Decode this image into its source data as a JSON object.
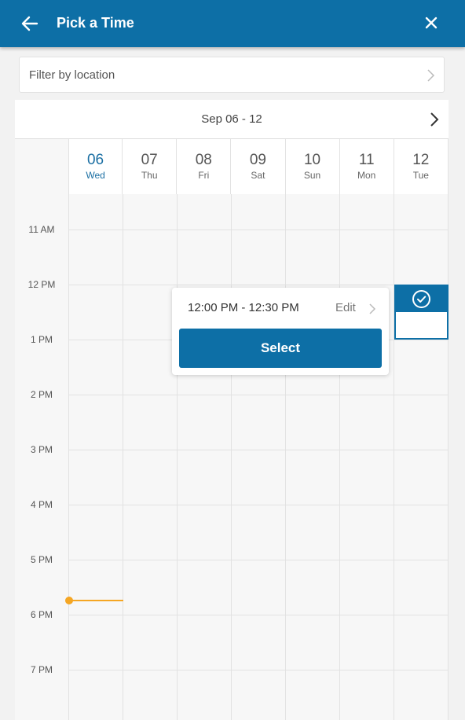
{
  "header": {
    "title": "Pick a Time",
    "back_icon": "arrow-left-icon",
    "close_icon": "close-icon"
  },
  "filter": {
    "label": "Filter by location",
    "icon": "chevron-right-icon"
  },
  "calendar": {
    "week_range": "Sep 06 - 12",
    "next_icon": "chevron-right-icon",
    "days": [
      {
        "num": "06",
        "dow": "Wed",
        "today": true
      },
      {
        "num": "07",
        "dow": "Thu"
      },
      {
        "num": "08",
        "dow": "Fri"
      },
      {
        "num": "09",
        "dow": "Sat"
      },
      {
        "num": "10",
        "dow": "Sun"
      },
      {
        "num": "11",
        "dow": "Mon"
      },
      {
        "num": "12",
        "dow": "Tue"
      }
    ],
    "times": [
      "11 AM",
      "12 PM",
      "1 PM",
      "2 PM",
      "3 PM",
      "4 PM",
      "5 PM",
      "6 PM",
      "7 PM"
    ],
    "selected_slot": {
      "day": "12",
      "check_icon": "check-circle-icon"
    }
  },
  "popup": {
    "time_range": "12:00 PM - 12:30 PM",
    "edit_label": "Edit",
    "select_label": "Select"
  },
  "colors": {
    "primary": "#0d6fa6",
    "now_indicator": "#f5a623"
  }
}
